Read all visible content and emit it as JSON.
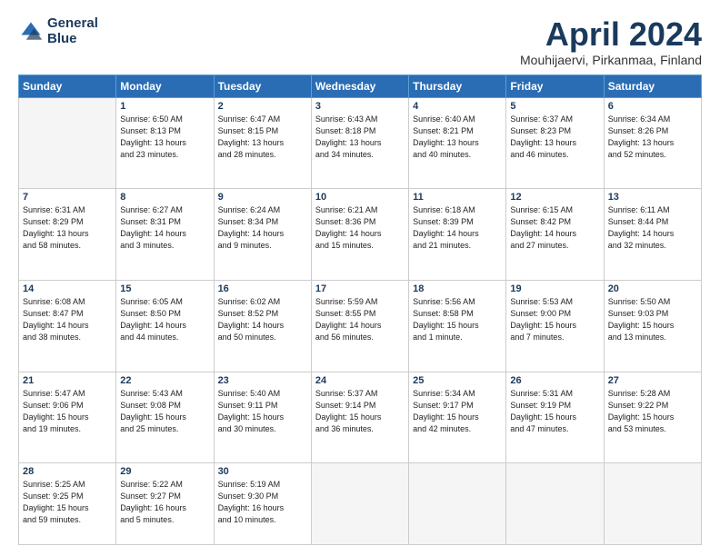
{
  "logo": {
    "line1": "General",
    "line2": "Blue"
  },
  "title": "April 2024",
  "location": "Mouhijaervi, Pirkanmaa, Finland",
  "headers": [
    "Sunday",
    "Monday",
    "Tuesday",
    "Wednesday",
    "Thursday",
    "Friday",
    "Saturday"
  ],
  "weeks": [
    [
      {
        "day": "",
        "detail": ""
      },
      {
        "day": "1",
        "detail": "Sunrise: 6:50 AM\nSunset: 8:13 PM\nDaylight: 13 hours\nand 23 minutes."
      },
      {
        "day": "2",
        "detail": "Sunrise: 6:47 AM\nSunset: 8:15 PM\nDaylight: 13 hours\nand 28 minutes."
      },
      {
        "day": "3",
        "detail": "Sunrise: 6:43 AM\nSunset: 8:18 PM\nDaylight: 13 hours\nand 34 minutes."
      },
      {
        "day": "4",
        "detail": "Sunrise: 6:40 AM\nSunset: 8:21 PM\nDaylight: 13 hours\nand 40 minutes."
      },
      {
        "day": "5",
        "detail": "Sunrise: 6:37 AM\nSunset: 8:23 PM\nDaylight: 13 hours\nand 46 minutes."
      },
      {
        "day": "6",
        "detail": "Sunrise: 6:34 AM\nSunset: 8:26 PM\nDaylight: 13 hours\nand 52 minutes."
      }
    ],
    [
      {
        "day": "7",
        "detail": "Sunrise: 6:31 AM\nSunset: 8:29 PM\nDaylight: 13 hours\nand 58 minutes."
      },
      {
        "day": "8",
        "detail": "Sunrise: 6:27 AM\nSunset: 8:31 PM\nDaylight: 14 hours\nand 3 minutes."
      },
      {
        "day": "9",
        "detail": "Sunrise: 6:24 AM\nSunset: 8:34 PM\nDaylight: 14 hours\nand 9 minutes."
      },
      {
        "day": "10",
        "detail": "Sunrise: 6:21 AM\nSunset: 8:36 PM\nDaylight: 14 hours\nand 15 minutes."
      },
      {
        "day": "11",
        "detail": "Sunrise: 6:18 AM\nSunset: 8:39 PM\nDaylight: 14 hours\nand 21 minutes."
      },
      {
        "day": "12",
        "detail": "Sunrise: 6:15 AM\nSunset: 8:42 PM\nDaylight: 14 hours\nand 27 minutes."
      },
      {
        "day": "13",
        "detail": "Sunrise: 6:11 AM\nSunset: 8:44 PM\nDaylight: 14 hours\nand 32 minutes."
      }
    ],
    [
      {
        "day": "14",
        "detail": "Sunrise: 6:08 AM\nSunset: 8:47 PM\nDaylight: 14 hours\nand 38 minutes."
      },
      {
        "day": "15",
        "detail": "Sunrise: 6:05 AM\nSunset: 8:50 PM\nDaylight: 14 hours\nand 44 minutes."
      },
      {
        "day": "16",
        "detail": "Sunrise: 6:02 AM\nSunset: 8:52 PM\nDaylight: 14 hours\nand 50 minutes."
      },
      {
        "day": "17",
        "detail": "Sunrise: 5:59 AM\nSunset: 8:55 PM\nDaylight: 14 hours\nand 56 minutes."
      },
      {
        "day": "18",
        "detail": "Sunrise: 5:56 AM\nSunset: 8:58 PM\nDaylight: 15 hours\nand 1 minute."
      },
      {
        "day": "19",
        "detail": "Sunrise: 5:53 AM\nSunset: 9:00 PM\nDaylight: 15 hours\nand 7 minutes."
      },
      {
        "day": "20",
        "detail": "Sunrise: 5:50 AM\nSunset: 9:03 PM\nDaylight: 15 hours\nand 13 minutes."
      }
    ],
    [
      {
        "day": "21",
        "detail": "Sunrise: 5:47 AM\nSunset: 9:06 PM\nDaylight: 15 hours\nand 19 minutes."
      },
      {
        "day": "22",
        "detail": "Sunrise: 5:43 AM\nSunset: 9:08 PM\nDaylight: 15 hours\nand 25 minutes."
      },
      {
        "day": "23",
        "detail": "Sunrise: 5:40 AM\nSunset: 9:11 PM\nDaylight: 15 hours\nand 30 minutes."
      },
      {
        "day": "24",
        "detail": "Sunrise: 5:37 AM\nSunset: 9:14 PM\nDaylight: 15 hours\nand 36 minutes."
      },
      {
        "day": "25",
        "detail": "Sunrise: 5:34 AM\nSunset: 9:17 PM\nDaylight: 15 hours\nand 42 minutes."
      },
      {
        "day": "26",
        "detail": "Sunrise: 5:31 AM\nSunset: 9:19 PM\nDaylight: 15 hours\nand 47 minutes."
      },
      {
        "day": "27",
        "detail": "Sunrise: 5:28 AM\nSunset: 9:22 PM\nDaylight: 15 hours\nand 53 minutes."
      }
    ],
    [
      {
        "day": "28",
        "detail": "Sunrise: 5:25 AM\nSunset: 9:25 PM\nDaylight: 15 hours\nand 59 minutes."
      },
      {
        "day": "29",
        "detail": "Sunrise: 5:22 AM\nSunset: 9:27 PM\nDaylight: 16 hours\nand 5 minutes."
      },
      {
        "day": "30",
        "detail": "Sunrise: 5:19 AM\nSunset: 9:30 PM\nDaylight: 16 hours\nand 10 minutes."
      },
      {
        "day": "",
        "detail": ""
      },
      {
        "day": "",
        "detail": ""
      },
      {
        "day": "",
        "detail": ""
      },
      {
        "day": "",
        "detail": ""
      }
    ]
  ]
}
